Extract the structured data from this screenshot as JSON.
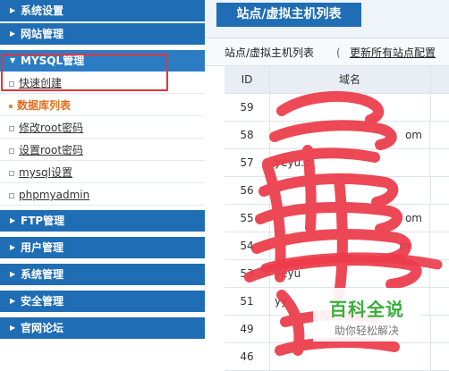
{
  "sidebar": {
    "sections_top": [
      {
        "label": "系统设置"
      },
      {
        "label": "网站管理"
      },
      {
        "label": "MYSQL管理"
      }
    ],
    "mysql_items": [
      {
        "label": "快速创建"
      },
      {
        "label": "数据库列表"
      },
      {
        "label": "修改root密码"
      },
      {
        "label": "设置root密码"
      },
      {
        "label": "mysql设置"
      },
      {
        "label": "phpmyadmin"
      }
    ],
    "sections_bottom": [
      {
        "label": "FTP管理"
      },
      {
        "label": "用户管理"
      },
      {
        "label": "系统管理"
      },
      {
        "label": "安全管理"
      },
      {
        "label": "官网论坛"
      }
    ]
  },
  "main": {
    "tab_title": "站点/虚拟主机列表",
    "breadcrumb_title": "站点/虚拟主机列表",
    "separator": "(",
    "refresh_link": "更新所有站点配置",
    "table": {
      "columns": [
        "ID",
        "域名"
      ],
      "rows": [
        {
          "id": "59",
          "domain": ""
        },
        {
          "id": "58",
          "domain": "om"
        },
        {
          "id": "57",
          "domain": "yeyu.c"
        },
        {
          "id": "56",
          "domain": ""
        },
        {
          "id": "55",
          "domain": "om"
        },
        {
          "id": "54",
          "domain": "m"
        },
        {
          "id": "53",
          "domain": "yeyu"
        },
        {
          "id": "51",
          "domain": "yy"
        },
        {
          "id": "49",
          "domain": ""
        },
        {
          "id": "46",
          "domain": ""
        }
      ]
    }
  },
  "watermark": {
    "title": "百科全说",
    "subtitle": "助你轻松解决"
  },
  "colors": {
    "nav": "#1f6db4",
    "active": "#e46d1a",
    "highlight": "#e5343a",
    "scribble": "#ec3b4a"
  }
}
